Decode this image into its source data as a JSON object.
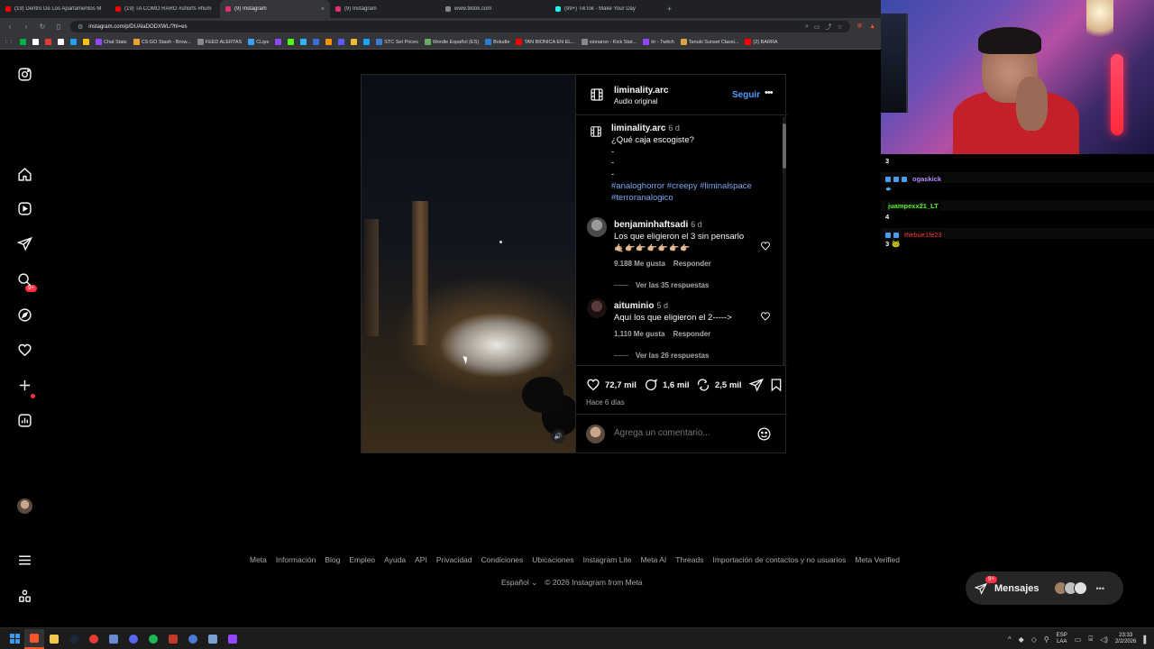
{
  "browser": {
    "tabs": [
      {
        "label": "(19) Dentro De Los Apartamentos M",
        "color": "#ff0000",
        "active": false
      },
      {
        "label": "(19) TA COMO RARO #shorts #hum",
        "color": "#ff0000",
        "active": false
      },
      {
        "label": "(9) Instagram",
        "color": "#e1306c",
        "active": true
      },
      {
        "label": "(9) Instagram",
        "color": "#e1306c",
        "active": false
      },
      {
        "label": "www.tiktok.com",
        "color": "#888888",
        "active": false
      },
      {
        "label": "(99+) TikTok - Make Your Day",
        "color": "#25f4ee",
        "active": false
      }
    ],
    "tab_close": "×",
    "new_tab": "+",
    "url": "instagram.com/p/DUAlaDODXWL/?hl=es",
    "bookmarks": [
      {
        "label": "",
        "color": "#00b341"
      },
      {
        "label": "",
        "color": "#ffffff"
      },
      {
        "label": "",
        "color": "#e53935"
      },
      {
        "label": "",
        "color": "#ffffff"
      },
      {
        "label": "",
        "color": "#1da1f2"
      },
      {
        "label": "",
        "color": "#ffc107"
      },
      {
        "label": "Chat Stats",
        "color": "#9146ff"
      },
      {
        "label": "CS:GO Stash - Brow...",
        "color": "#f0a030"
      },
      {
        "label": "FEED ALERTAS",
        "color": "#888888"
      },
      {
        "label": "CLips",
        "color": "#3aa0ff"
      },
      {
        "label": "",
        "color": "#9146ff"
      },
      {
        "label": "",
        "color": "#53fc18"
      },
      {
        "label": "",
        "color": "#2fb5f5"
      },
      {
        "label": "",
        "color": "#3f6de0"
      },
      {
        "label": "",
        "color": "#ff9100"
      },
      {
        "label": "",
        "color": "#5a5aff"
      },
      {
        "label": "",
        "color": "#f3ba2f"
      },
      {
        "label": "",
        "color": "#1aa3ff"
      },
      {
        "label": "STC Set Prices",
        "color": "#3a7bd5"
      },
      {
        "label": "Wordle Español (ES)",
        "color": "#6aaa64"
      },
      {
        "label": "Boludle",
        "color": "#2a7bd5"
      },
      {
        "label": "TAN BIONICA EN EL...",
        "color": "#ff0000"
      },
      {
        "label": "sionaron - Kick Stat...",
        "color": "#888888"
      },
      {
        "label": "trr - Twitch",
        "color": "#9146ff"
      },
      {
        "label": "Tanuki Sunset Classi...",
        "color": "#d9a441"
      },
      {
        "label": "(2) BARRA",
        "color": "#ff0000"
      }
    ]
  },
  "instagram": {
    "nav_badge": "9+",
    "post": {
      "username": "liminality.arc",
      "audio": "Audio original",
      "follow": "Seguir",
      "more": "•••",
      "caption_user": "liminality.arc",
      "caption_time": "6 d",
      "caption_text": "¿Qué caja escogiste?\n-\n-\n-",
      "hashtags": "#analoghorror #creepy #liminalspace #terroranalogico",
      "comments": [
        {
          "user": "benjaminhaftsadi",
          "time": "6 d",
          "text": "Los que eligieron el 3 sin pensarlo",
          "emojis": "🤙🏼👉🏼👉🏼👉🏼👉🏼👉🏼👉🏼",
          "likes": "9.188 Me gusta",
          "reply": "Responder",
          "view_replies": "Ver las 35 respuestas",
          "avatar_color": "#6e6e6e"
        },
        {
          "user": "aituminio",
          "time": "5 d",
          "text": "Aquí los que eligieron el 2----->",
          "emojis": "",
          "likes": "1.110 Me gusta",
          "reply": "Responder",
          "view_replies": "Ver las 26 respuestas",
          "avatar_color": "#3a2a2a"
        }
      ],
      "likes": "72,7 mil",
      "comment_count": "1,6 mil",
      "reposts": "2,5 mil",
      "posted": "Hace 6 días",
      "comment_placeholder": "Agrega un comentario..."
    },
    "footer_links": [
      "Meta",
      "Información",
      "Blog",
      "Empleo",
      "Ayuda",
      "API",
      "Privacidad",
      "Condiciones",
      "Ubicaciones",
      "Instagram Lite",
      "Meta AI",
      "Threads",
      "Importación de contactos y no usuarios",
      "Meta Verified"
    ],
    "language": "Español",
    "copyright": "© 2026 Instagram from Meta",
    "messages": {
      "label": "Mensajes",
      "badge": "9+",
      "more": "•••"
    }
  },
  "stream_chat": [
    {
      "user": "3",
      "color": "#ffffff"
    },
    {
      "user": "ogaskick",
      "color": "#b487ff"
    },
    {
      "user": "juampexx21_LT",
      "color": "#53fc18"
    },
    {
      "user": "4",
      "color": "#ffffff"
    },
    {
      "user": "thebue1fe23",
      "color": "#ff3a3a"
    },
    {
      "user": "3",
      "color": "#ffffff"
    }
  ],
  "taskbar": {
    "lang1": "ESP",
    "lang2": "LAA",
    "time": "23:33",
    "date": "2/2/2026"
  }
}
